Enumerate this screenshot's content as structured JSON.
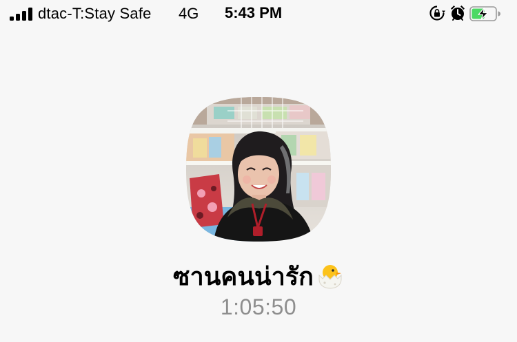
{
  "status_bar": {
    "carrier": "dtac-T:Stay Safe",
    "network": "4G",
    "time": "5:43 PM",
    "signal_bars": 4,
    "battery_level": 0.55,
    "battery_charging": true,
    "battery_color": "#4cd964"
  },
  "call": {
    "contact_name": "ซานคนน่ารัก",
    "contact_emoji": "hatching-chick-icon",
    "duration": "1:05:50"
  }
}
